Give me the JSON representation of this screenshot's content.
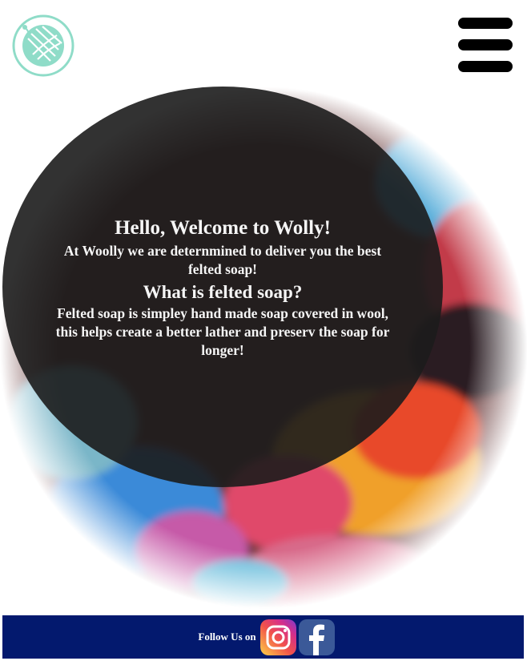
{
  "header": {
    "logo_icon": "yarn-ball-icon",
    "menu_icon": "hamburger-menu-icon"
  },
  "hero": {
    "title": "Hello, Welcome to Wolly!",
    "intro": "At Woolly we are deternmined to deliver you the best felted soap!",
    "question": "What is felted soap?",
    "answer": "Felted soap is simpley hand made soap covered in wool, this helps create a better lather and preserv the soap for longer!"
  },
  "footer": {
    "follow_label": "Follow Us on",
    "social": [
      {
        "name": "instagram",
        "icon": "instagram-icon"
      },
      {
        "name": "facebook",
        "icon": "facebook-icon"
      }
    ]
  },
  "colors": {
    "logo_teal": "#8fdcc8",
    "footer_bg": "#03196e",
    "facebook_blue": "#3b5998"
  }
}
